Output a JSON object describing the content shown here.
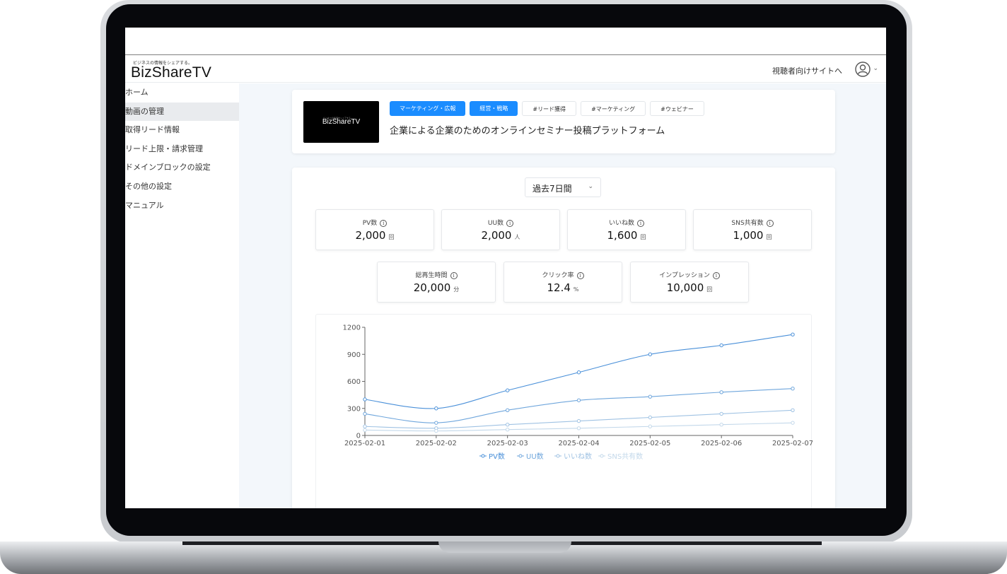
{
  "header": {
    "logo_tagline": "ビジネスの情報をシェアする。",
    "logo": "BizShareTV",
    "viewer_link": "視聴者向けサイトへ"
  },
  "sidebar": {
    "items": [
      {
        "label": "ホーム",
        "active": false
      },
      {
        "label": "動画の管理",
        "active": true
      },
      {
        "label": "取得リード情報",
        "active": false
      },
      {
        "label": "リード上限・請求管理",
        "active": false
      },
      {
        "label": "ドメインブロックの設定",
        "active": false
      },
      {
        "label": "その他の設定",
        "active": false
      },
      {
        "label": "マニュアル",
        "active": false
      }
    ]
  },
  "video": {
    "thumbnail_title": "BizShareTV",
    "thumbnail_tagline": "ビジネスの情報をシェアする。",
    "categories": [
      "マーケティング・広報",
      "経営・戦略"
    ],
    "hashtags": [
      "#リード獲得",
      "#マーケティング",
      "#ウェビナー"
    ],
    "title": "企業による企業のためのオンラインセミナー投稿プラットフォーム"
  },
  "stats": {
    "period": "過去7日間",
    "metrics": [
      {
        "label": "PV数",
        "value": "2,000",
        "unit": "回"
      },
      {
        "label": "UU数",
        "value": "2,000",
        "unit": "人"
      },
      {
        "label": "いいね数",
        "value": "1,600",
        "unit": "回"
      },
      {
        "label": "SNS共有数",
        "value": "1,000",
        "unit": "回"
      },
      {
        "label": "総再生時間",
        "value": "20,000",
        "unit": "分"
      },
      {
        "label": "クリック率",
        "value": "12.4",
        "unit": "%"
      },
      {
        "label": "インプレッション",
        "value": "10,000",
        "unit": "回"
      }
    ]
  },
  "chart_data": {
    "type": "line",
    "x": [
      "2025-02-01",
      "2025-02-02",
      "2025-02-03",
      "2025-02-04",
      "2025-02-05",
      "2025-02-06",
      "2025-02-07"
    ],
    "ylim": [
      0,
      1200
    ],
    "yticks": [
      0,
      300,
      600,
      900,
      1200
    ],
    "legend": "bottom-center",
    "grid": false,
    "series": [
      {
        "name": "PV数",
        "color": "#4a90d9",
        "values": [
          400,
          300,
          500,
          700,
          900,
          1000,
          1120
        ]
      },
      {
        "name": "UU数",
        "color": "#6fa6dc",
        "values": [
          240,
          140,
          280,
          390,
          430,
          480,
          520
        ]
      },
      {
        "name": "いいね数",
        "color": "#9fc2e3",
        "values": [
          100,
          80,
          120,
          160,
          200,
          240,
          280
        ]
      },
      {
        "name": "SNS共有数",
        "color": "#c3d8ea",
        "values": [
          60,
          50,
          65,
          80,
          100,
          120,
          140
        ]
      }
    ]
  }
}
